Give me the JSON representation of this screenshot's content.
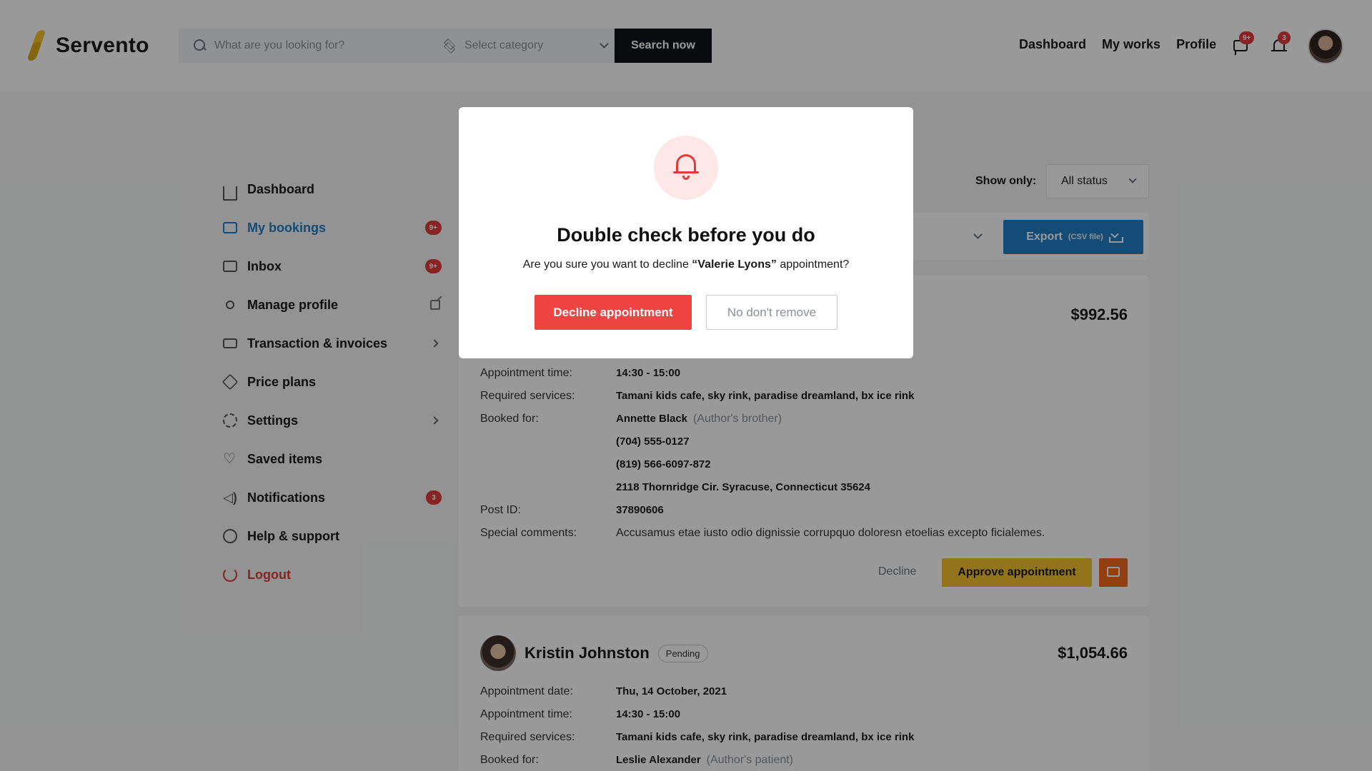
{
  "header": {
    "brand": "Servento",
    "search_placeholder": "What are you looking for?",
    "category_placeholder": "Select category",
    "search_button": "Search now",
    "nav": [
      "Dashboard",
      "My works",
      "Profile"
    ],
    "messages_badge": "9+",
    "notifications_badge": "3"
  },
  "sidebar": {
    "items": [
      {
        "label": "Dashboard",
        "icon": "home-icon"
      },
      {
        "label": "My bookings",
        "icon": "folder-icon",
        "badge": "9+",
        "active": true
      },
      {
        "label": "Inbox",
        "icon": "chat-icon",
        "badge": "9+"
      },
      {
        "label": "Manage profile",
        "icon": "user-icon"
      },
      {
        "label": "Transaction & invoices",
        "icon": "card-icon"
      },
      {
        "label": "Price plans",
        "icon": "box-icon"
      },
      {
        "label": "Settings",
        "icon": "gear-icon"
      },
      {
        "label": "Saved items",
        "icon": "heart-icon"
      },
      {
        "label": "Notifications",
        "icon": "speaker-icon",
        "badge": "3"
      },
      {
        "label": "Help & support",
        "icon": "info-icon"
      },
      {
        "label": "Logout",
        "icon": "power-icon"
      }
    ]
  },
  "filters": {
    "show_only_label": "Show only:",
    "status_value": "All status",
    "export_label": "Export",
    "export_sub": "(CSV file)"
  },
  "booking1": {
    "price": "$992.56",
    "rows": {
      "time_label": "Appointment time:",
      "time": "14:30 - 15:00",
      "services_label": "Required services:",
      "services": "Tamani kids cafe,  sky rink,  paradise dreamland,  bx ice rink",
      "booked_label": "Booked for:",
      "booked_name": "Annette Black",
      "booked_rel": "(Author's brother)",
      "phone1": "(704) 555-0127",
      "phone2": "(819) 566-6097-872",
      "address": "2118 Thornridge Cir. Syracuse, Connecticut 35624",
      "post_label": "Post ID:",
      "post_id": "37890606",
      "comments_label": "Special comments:",
      "comments": "Accusamus etae iusto odio dignissie corrupquo doloresn etoelias excepto ficialemes."
    },
    "decline": "Decline",
    "approve": "Approve appointment"
  },
  "booking2": {
    "name": "Kristin Johnston",
    "status": "Pending",
    "price": "$1,054.66",
    "rows": {
      "date_label": "Appointment date:",
      "date": "Thu, 14 October, 2021",
      "time_label": "Appointment time:",
      "time": "14:30 - 15:00",
      "services_label": "Required services:",
      "services": "Tamani kids cafe,  sky rink,  paradise dreamland,  bx ice rink",
      "booked_label": "Booked for:",
      "booked_name": "Leslie Alexander",
      "booked_rel": "(Author's patient)"
    }
  },
  "modal": {
    "title": "Double check before you do",
    "text_before": "Are you sure you want to decline ",
    "name": "“Valerie Lyons”",
    "text_after": " appointment?",
    "confirm": "Decline appointment",
    "cancel": "No don't remove"
  },
  "colors": {
    "accent_blue": "#1f7fc6",
    "danger": "#ef4444",
    "approve": "#f2c230",
    "message": "#f26a1b"
  }
}
